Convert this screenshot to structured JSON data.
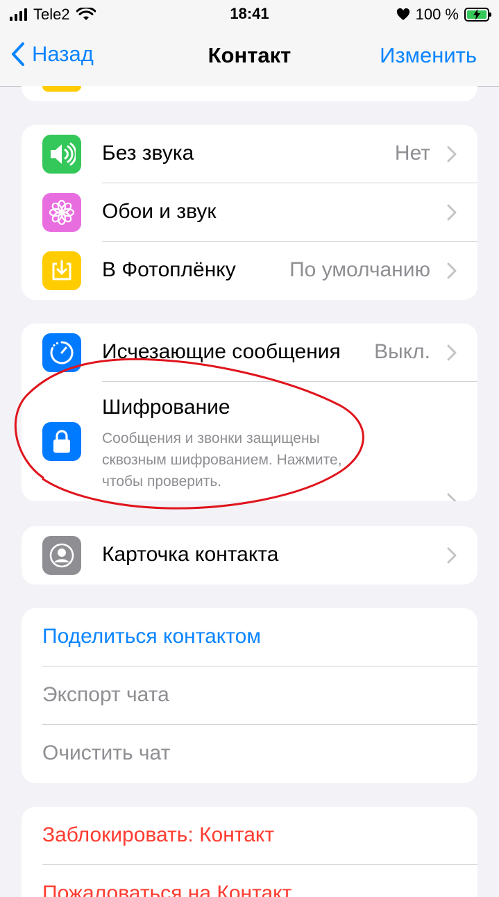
{
  "status_bar": {
    "carrier": "Tele2",
    "time": "18:41",
    "battery": "100 %"
  },
  "nav": {
    "back_label": "Назад",
    "title": "Контакт",
    "edit_label": "Изменить"
  },
  "settings_group": [
    {
      "label": "Без звука",
      "value": "Нет",
      "icon": "speaker-icon",
      "color": "#34c759"
    },
    {
      "label": "Обои и звук",
      "value": "",
      "icon": "flower-icon",
      "color": "#e86ee0"
    },
    {
      "label": "В Фотоплёнку",
      "value": "По умолчанию",
      "icon": "save-to-photos-icon",
      "color": "#ffcc00"
    }
  ],
  "privacy_group": {
    "disappearing": {
      "label": "Исчезающие сообщения",
      "value": "Выкл.",
      "icon": "timer-icon",
      "color": "#007aff"
    },
    "encryption": {
      "label": "Шифрование",
      "desc_line1": "Сообщения и звонки защищены",
      "desc_line2": "сквозным шифрованием. Нажмите,",
      "desc_line3": "чтобы проверить.",
      "icon": "lock-icon",
      "color": "#007aff"
    }
  },
  "contact_card": {
    "label": "Карточка контакта",
    "icon": "contact-card-icon",
    "color": "#8e8e93"
  },
  "actions": {
    "share": "Поделиться контактом",
    "export": "Экспорт чата",
    "clear": "Очистить чат"
  },
  "danger": {
    "block": "Заблокировать: Контакт",
    "report": "Пожаловаться на Контакт"
  },
  "colors": {
    "accent": "#0a84ff",
    "danger": "#ff3b30",
    "annotation": "#e0141c"
  }
}
